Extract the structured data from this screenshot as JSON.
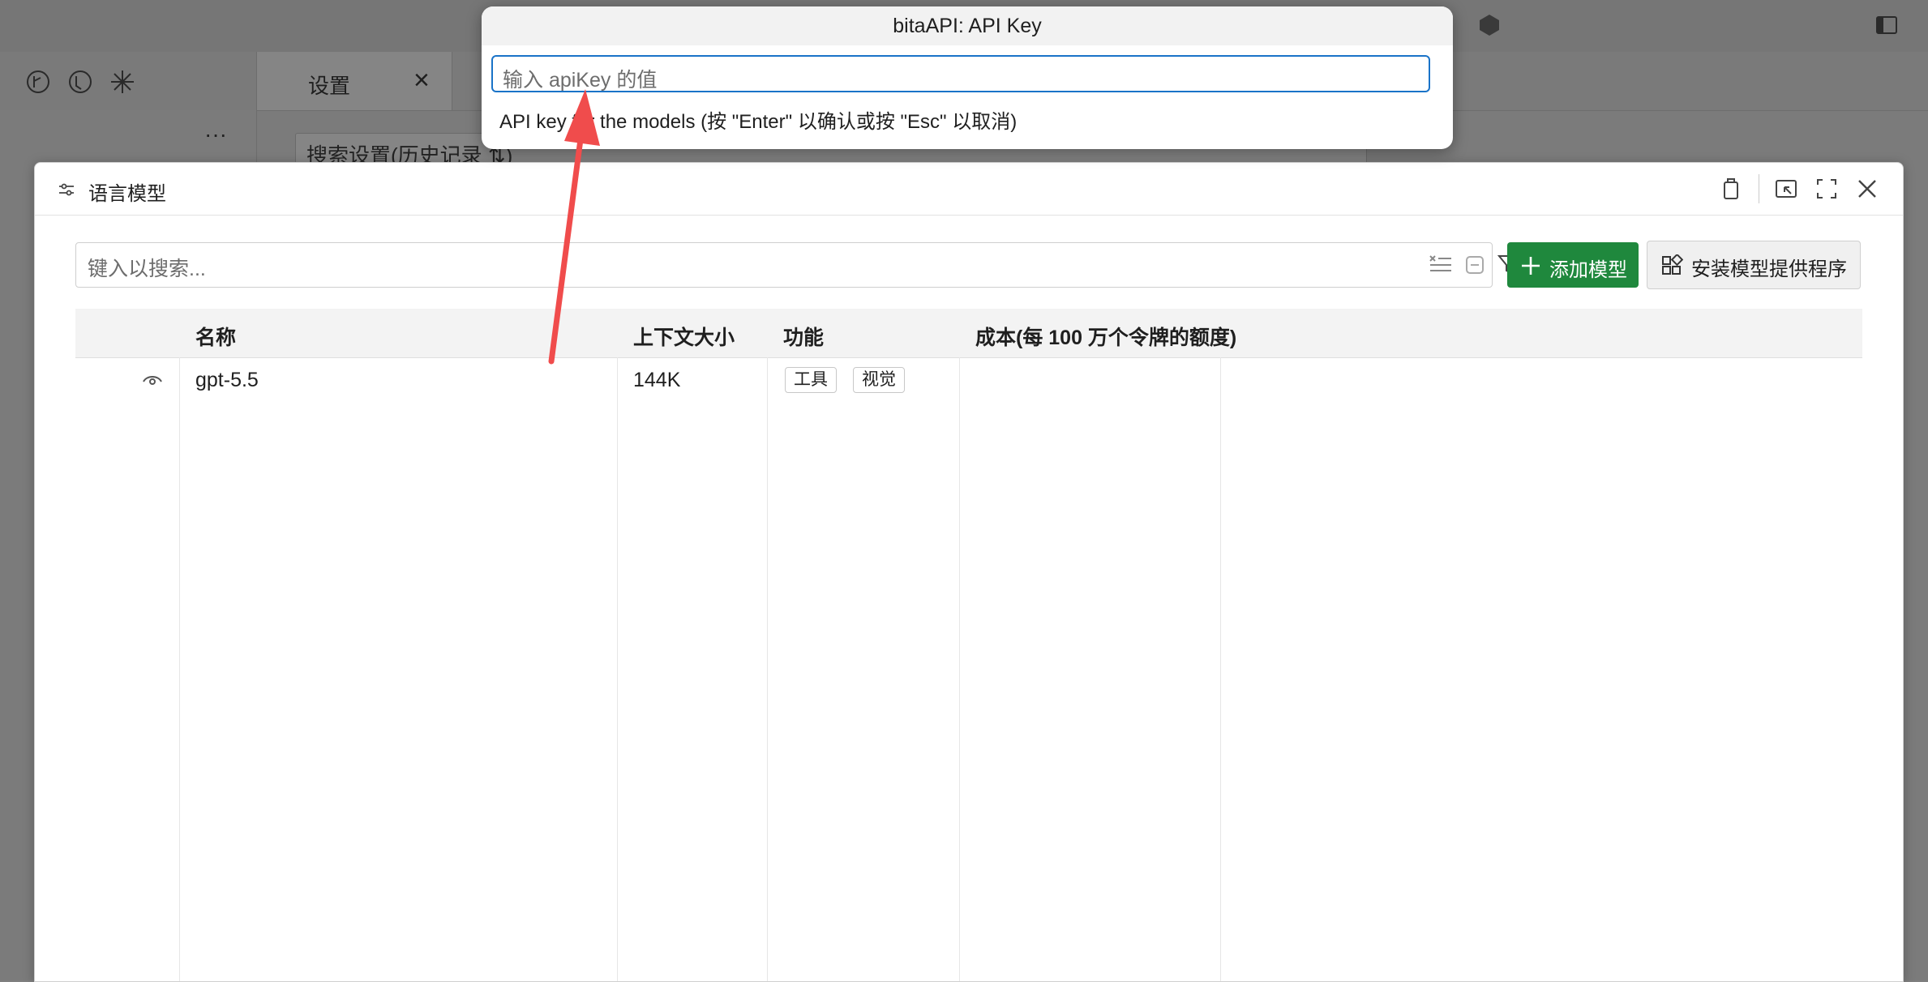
{
  "quick_input": {
    "title": "bitaAPI: API Key",
    "placeholder": "输入 apiKey 的值",
    "message": "API key for the models (按 \"Enter\" 以确认或按 \"Esc\" 以取消)"
  },
  "background": {
    "tab_label": "设置",
    "search_text": "搜索设置(历史记录 ⇅)",
    "more": "···"
  },
  "dialog": {
    "title": "语言模型",
    "search_placeholder": "键入以搜索...",
    "add_button": "添加模型",
    "install_button": "安装模型提供程序",
    "columns": [
      "名称",
      "上下文大小",
      "功能",
      "成本(每 100 万个令牌的额度)"
    ],
    "rows": [
      {
        "name": "gpt-5.5",
        "context": "144K",
        "capabilities": [
          "工具",
          "视觉"
        ]
      }
    ]
  },
  "colors": {
    "accent_blue": "#1a73c8",
    "add_green": "#1f883d",
    "annotation_red": "#f04c4c"
  },
  "icons": [
    "settings-sliders-icon",
    "close-icon",
    "eye-icon",
    "plus-icon",
    "extensions-icon",
    "filter-icon",
    "clear-filter-icon",
    "collapse-icon",
    "popout-icon",
    "restore-icon",
    "maximize-icon",
    "more-icon"
  ]
}
